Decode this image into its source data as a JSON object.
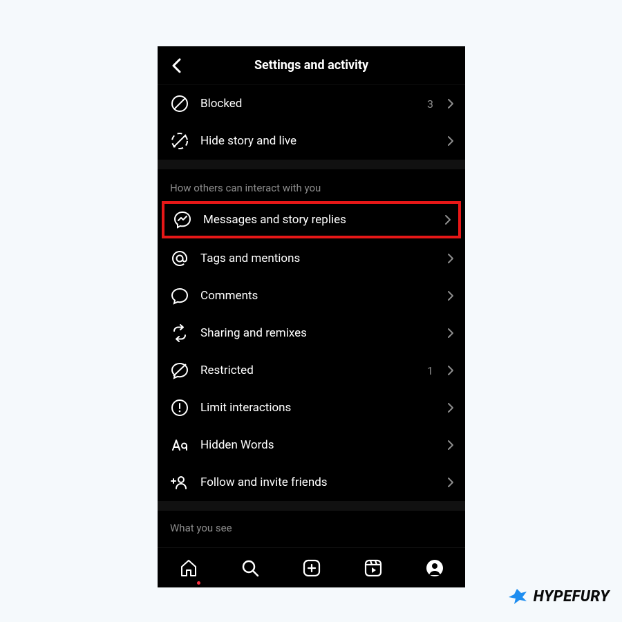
{
  "header": {
    "title": "Settings and activity"
  },
  "section1": {
    "blocked": {
      "label": "Blocked",
      "count": "3"
    },
    "hide_story": {
      "label": "Hide story and live"
    }
  },
  "section2": {
    "title": "How others can interact with you",
    "messages": {
      "label": "Messages and story replies"
    },
    "tags": {
      "label": "Tags and mentions"
    },
    "comments": {
      "label": "Comments"
    },
    "sharing": {
      "label": "Sharing and remixes"
    },
    "restricted": {
      "label": "Restricted",
      "count": "1"
    },
    "limit": {
      "label": "Limit interactions"
    },
    "hidden_words": {
      "label": "Hidden Words"
    },
    "follow": {
      "label": "Follow and invite friends"
    }
  },
  "section3": {
    "title": "What you see"
  },
  "watermark": {
    "text": "HYPEFURY"
  }
}
